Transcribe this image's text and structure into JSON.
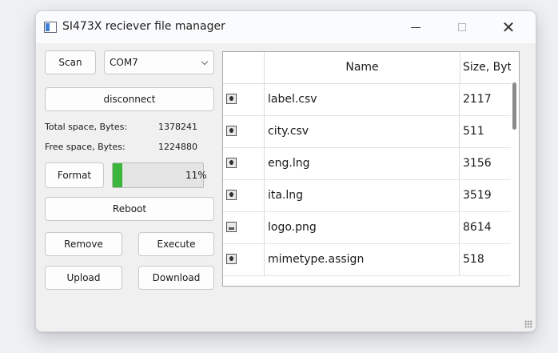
{
  "window": {
    "title": "SI473X reciever file manager"
  },
  "controls": {
    "scan_label": "Scan",
    "port_value": "COM7",
    "disconnect_label": "disconnect",
    "total_space_label": "Total space, Bytes:",
    "total_space_value": "1378241",
    "free_space_label": "Free space, Bytes:",
    "free_space_value": "1224880",
    "format_label": "Format",
    "usage_percent": 11,
    "usage_text": "11%",
    "progress_color": "#3cb53c",
    "reboot_label": "Reboot",
    "remove_label": "Remove",
    "execute_label": "Execute",
    "upload_label": "Upload",
    "download_label": "Download"
  },
  "table": {
    "columns": [
      "",
      "Name",
      "Size, Byt"
    ],
    "rows": [
      {
        "icon": "file-icon",
        "name": "label.csv",
        "size": "2117"
      },
      {
        "icon": "file-icon",
        "name": "city.csv",
        "size": "511"
      },
      {
        "icon": "file-icon",
        "name": "eng.lng",
        "size": "3156"
      },
      {
        "icon": "file-icon",
        "name": "ita.lng",
        "size": "3519"
      },
      {
        "icon": "image-icon",
        "name": "logo.png",
        "size": "8614"
      },
      {
        "icon": "file-icon",
        "name": "mimetype.assign",
        "size": "518"
      },
      {
        "icon": "file-icon",
        "name": "",
        "size": ""
      }
    ]
  }
}
